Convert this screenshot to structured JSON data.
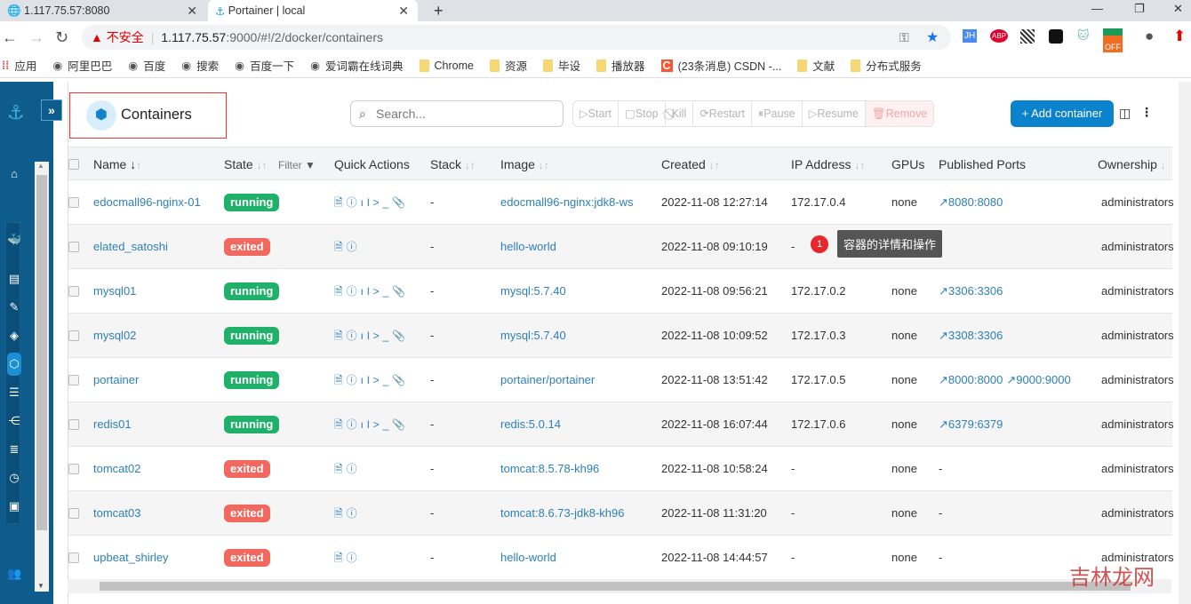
{
  "browser": {
    "tabs": [
      {
        "label": "1.117.75.57:8080",
        "icon": "globe-icon"
      },
      {
        "label": "Portainer | local",
        "icon": "portainer-icon"
      }
    ],
    "security_label": "不安全",
    "url_host": "1.117.75.57",
    "url_rest": ":9000/#!/2/docker/containers",
    "bookmarks": [
      "应用",
      "阿里巴巴",
      "百度",
      "搜索",
      "百度一下",
      "爱词霸在线词典",
      "Chrome",
      "资源",
      "毕设",
      "播放器",
      "(23条消息) CSDN -...",
      "文献",
      "分布式服务"
    ],
    "extensions": [
      "JH",
      "ABP",
      "OFF"
    ]
  },
  "sidebar": {
    "icons": [
      "home-icon",
      "docker-icon",
      "dashboard-icon",
      "edit-icon",
      "layers-icon",
      "containers-icon",
      "list-icon",
      "network-icon",
      "database-icon",
      "clock-icon",
      "board-icon",
      "users-icon"
    ],
    "active": "containers-icon"
  },
  "page": {
    "title": "Containers",
    "search_placeholder": "Search...",
    "actions": [
      "Start",
      "Stop",
      "Kill",
      "Restart",
      "Pause",
      "Resume",
      "Remove"
    ],
    "add_label": "+ Add container"
  },
  "table": {
    "columns": [
      "Name",
      "State",
      "Filter",
      "Quick Actions",
      "Stack",
      "Image",
      "Created",
      "IP Address",
      "GPUs",
      "Published Ports",
      "Ownership"
    ],
    "rows": [
      {
        "name": "edocmall96-nginx-01",
        "state": "running",
        "qa": "full",
        "stack": "-",
        "image": "edocmall96-nginx:jdk8-ws",
        "created": "2022-11-08 12:27:14",
        "ip": "172.17.0.4",
        "gpus": "none",
        "ports": [
          "8080:8080"
        ],
        "owner": "administrators"
      },
      {
        "name": "elated_satoshi",
        "state": "exited",
        "qa": "min",
        "stack": "-",
        "image": "hello-world",
        "created": "2022-11-08 09:10:19",
        "ip": "-",
        "gpus": "",
        "ports": [],
        "owner": "administrators"
      },
      {
        "name": "mysql01",
        "state": "running",
        "qa": "full",
        "stack": "-",
        "image": "mysql:5.7.40",
        "created": "2022-11-08 09:56:21",
        "ip": "172.17.0.2",
        "gpus": "none",
        "ports": [
          "3306:3306"
        ],
        "owner": "administrators"
      },
      {
        "name": "mysql02",
        "state": "running",
        "qa": "full",
        "stack": "-",
        "image": "mysql:5.7.40",
        "created": "2022-11-08 10:09:52",
        "ip": "172.17.0.3",
        "gpus": "none",
        "ports": [
          "3308:3306"
        ],
        "owner": "administrators"
      },
      {
        "name": "portainer",
        "state": "running",
        "qa": "full",
        "stack": "-",
        "image": "portainer/portainer",
        "created": "2022-11-08 13:51:42",
        "ip": "172.17.0.5",
        "gpus": "none",
        "ports": [
          "8000:8000",
          "9000:9000"
        ],
        "owner": "administrators"
      },
      {
        "name": "redis01",
        "state": "running",
        "qa": "full",
        "stack": "-",
        "image": "redis:5.0.14",
        "created": "2022-11-08 16:07:44",
        "ip": "172.17.0.6",
        "gpus": "none",
        "ports": [
          "6379:6379"
        ],
        "owner": "administrators"
      },
      {
        "name": "tomcat02",
        "state": "exited",
        "qa": "min",
        "stack": "-",
        "image": "tomcat:8.5.78-kh96",
        "created": "2022-11-08 10:58:24",
        "ip": "-",
        "gpus": "none",
        "ports": [
          "-"
        ],
        "owner": "administrators"
      },
      {
        "name": "tomcat03",
        "state": "exited",
        "qa": "min",
        "stack": "-",
        "image": "tomcat:8.6.73-jdk8-kh96",
        "created": "2022-11-08 11:31:20",
        "ip": "-",
        "gpus": "none",
        "ports": [
          "-"
        ],
        "owner": "administrators"
      },
      {
        "name": "upbeat_shirley",
        "state": "exited",
        "qa": "min",
        "stack": "-",
        "image": "hello-world",
        "created": "2022-11-08 14:44:57",
        "ip": "-",
        "gpus": "none",
        "ports": [
          "-"
        ],
        "owner": "administrators"
      }
    ]
  },
  "tooltip": {
    "number": "1",
    "text": "容器的详情和操作"
  },
  "watermark": "吉林龙网",
  "colors": {
    "running": "#1fb16a",
    "exited": "#f1685e",
    "accent": "#0b83cc",
    "sidebar": "#0d5c8c"
  }
}
